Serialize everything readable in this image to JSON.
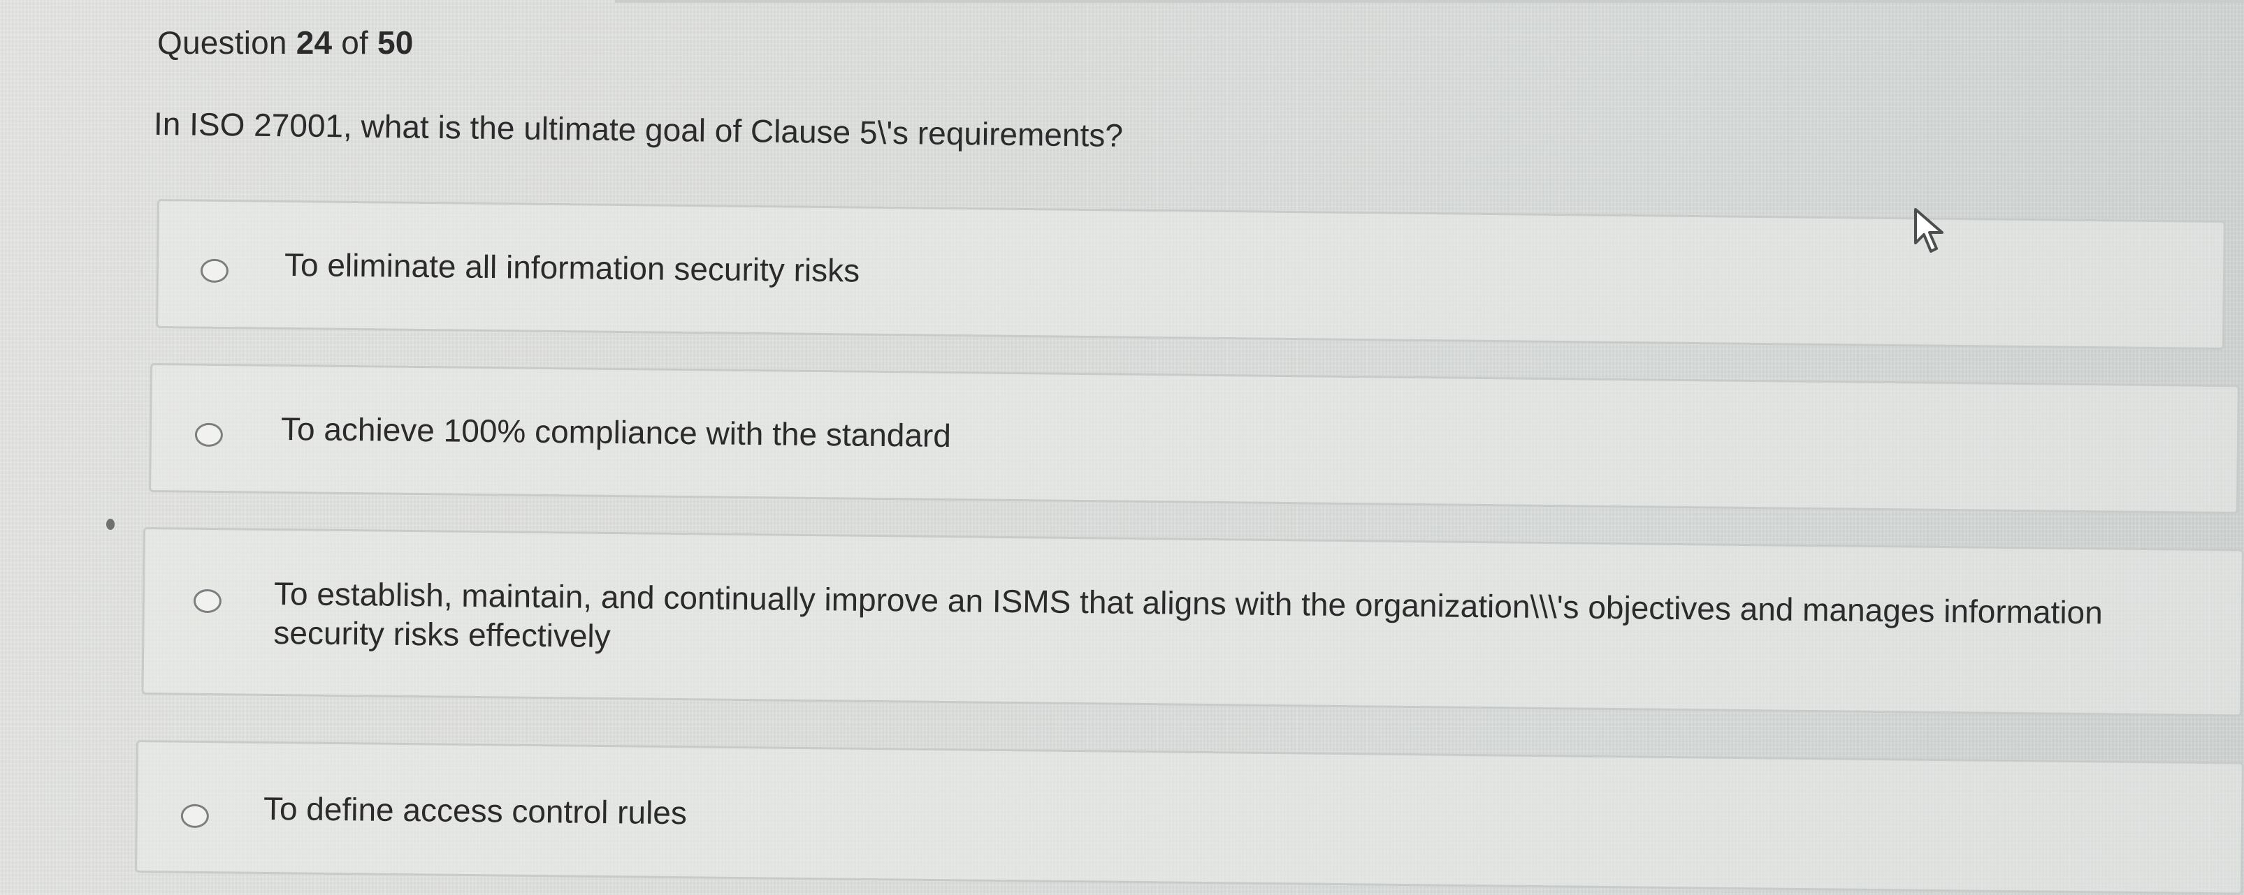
{
  "header": {
    "prefix": "Question",
    "current": "24",
    "separator": "of",
    "total": "50"
  },
  "question": {
    "text": "In ISO 27001, what is the ultimate goal of Clause 5\\'s requirements?"
  },
  "options": [
    {
      "label": "To eliminate all information security risks",
      "selected": false
    },
    {
      "label": "To achieve 100% compliance with the standard",
      "selected": false
    },
    {
      "label": "To establish, maintain, and continually improve an ISMS that aligns with the organization\\\\\\'s objectives and manages information security risks effectively",
      "selected": false
    },
    {
      "label": "To define access control rules",
      "selected": false
    }
  ],
  "cursor": {
    "icon": "mouse-pointer-icon"
  }
}
